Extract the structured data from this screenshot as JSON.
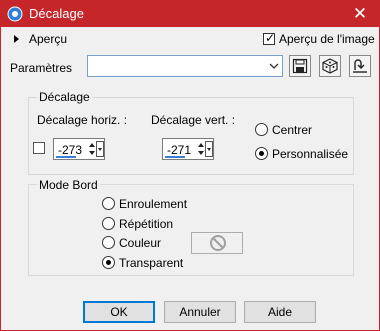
{
  "window": {
    "title": "Décalage"
  },
  "toolbar": {
    "preview_label": "Aperçu",
    "image_preview_label": "Aperçu de l'image",
    "image_preview_checked": true,
    "params_label": "Paramètres",
    "preset_value": ""
  },
  "offset_group": {
    "label": "Décalage",
    "horiz_label": "Décalage horiz. :",
    "vert_label": "Décalage vert. :",
    "horiz_value": "-273",
    "vert_value": "-271",
    "link_checked": false,
    "options": [
      {
        "label": "Centrer",
        "selected": false
      },
      {
        "label": "Personnalisée",
        "selected": true
      }
    ]
  },
  "edge_group": {
    "label": "Mode Bord",
    "options": [
      {
        "label": "Enroulement",
        "selected": false
      },
      {
        "label": "Répétition",
        "selected": false
      },
      {
        "label": "Couleur",
        "selected": false
      },
      {
        "label": "Transparent",
        "selected": true
      }
    ]
  },
  "buttons": {
    "ok": "OK",
    "cancel": "Annuler",
    "help": "Aide"
  },
  "colors": {
    "titlebar": "#c4262a",
    "accent": "#0078d7"
  }
}
